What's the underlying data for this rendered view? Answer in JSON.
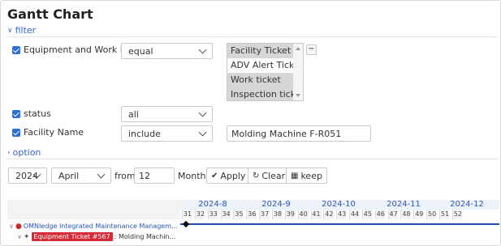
{
  "title": "Gantt Chart",
  "filter": {
    "toggle_label": "filter",
    "equipment_work_list": {
      "label": "Equipment and Work List",
      "operator": "equal",
      "options": [
        {
          "label": "Facility Ticket",
          "selected": true
        },
        {
          "label": "ADV Alert Ticket",
          "selected": false
        },
        {
          "label": "Work ticket",
          "selected": true
        },
        {
          "label": "Inspection ticket",
          "selected": true
        }
      ],
      "remove_label": "−"
    },
    "status": {
      "label": "status",
      "value": "all"
    },
    "facility_name": {
      "label": "Facility Name",
      "operator": "include",
      "value": "Molding Machine F-R051"
    }
  },
  "option": {
    "toggle_label": "option"
  },
  "controls": {
    "year": "2024",
    "month": "April",
    "from_label": "from",
    "months_value": "12",
    "months_label": "Months",
    "apply_label": "Apply",
    "clear_label": "Clear",
    "keep_label": "keep"
  },
  "gantt": {
    "months": [
      "2024-8",
      "2024-9",
      "2024-10",
      "2024-11",
      "2024-12"
    ],
    "weeks": [
      "31",
      "32",
      "33",
      "34",
      "35",
      "36",
      "37",
      "38",
      "39",
      "40",
      "41",
      "42",
      "43",
      "44",
      "45",
      "46",
      "47",
      "48",
      "49",
      "50",
      "51",
      "52"
    ],
    "rows": [
      {
        "name": "OMNIedge Integrated Maintenance Managem…"
      },
      {
        "badge": "Equipment Ticket #567",
        "detail": ": Molding Machin…"
      }
    ]
  },
  "colors": {
    "accent": "#2b6fd6",
    "link": "#3a67c8",
    "badge": "#d42b37",
    "bar": "#1f4fb0"
  }
}
